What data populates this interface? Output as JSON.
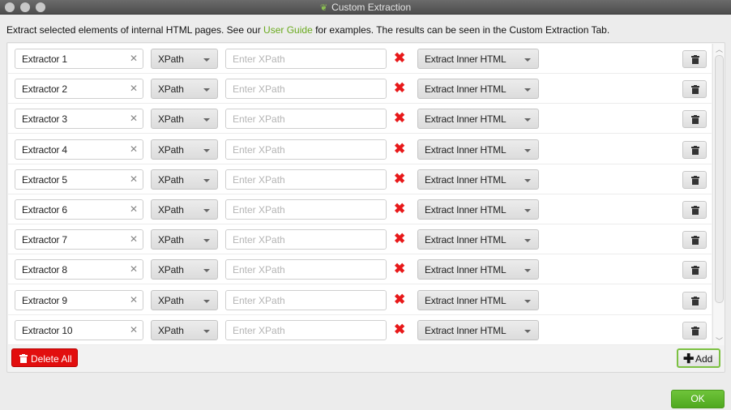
{
  "window": {
    "title": "Custom Extraction"
  },
  "description": {
    "before_link": "Extract selected elements of internal HTML pages. See our ",
    "link_text": "User Guide",
    "after_link": " for examples. The results can be seen in the Custom Extraction Tab."
  },
  "extractors": [
    {
      "name": "Extractor 1",
      "type": "XPath",
      "expression_placeholder": "Enter XPath",
      "mode": "Extract Inner HTML"
    },
    {
      "name": "Extractor 2",
      "type": "XPath",
      "expression_placeholder": "Enter XPath",
      "mode": "Extract Inner HTML"
    },
    {
      "name": "Extractor 3",
      "type": "XPath",
      "expression_placeholder": "Enter XPath",
      "mode": "Extract Inner HTML"
    },
    {
      "name": "Extractor 4",
      "type": "XPath",
      "expression_placeholder": "Enter XPath",
      "mode": "Extract Inner HTML"
    },
    {
      "name": "Extractor 5",
      "type": "XPath",
      "expression_placeholder": "Enter XPath",
      "mode": "Extract Inner HTML"
    },
    {
      "name": "Extractor 6",
      "type": "XPath",
      "expression_placeholder": "Enter XPath",
      "mode": "Extract Inner HTML"
    },
    {
      "name": "Extractor 7",
      "type": "XPath",
      "expression_placeholder": "Enter XPath",
      "mode": "Extract Inner HTML"
    },
    {
      "name": "Extractor 8",
      "type": "XPath",
      "expression_placeholder": "Enter XPath",
      "mode": "Extract Inner HTML"
    },
    {
      "name": "Extractor 9",
      "type": "XPath",
      "expression_placeholder": "Enter XPath",
      "mode": "Extract Inner HTML"
    },
    {
      "name": "Extractor 10",
      "type": "XPath",
      "expression_placeholder": "Enter XPath",
      "mode": "Extract Inner HTML"
    }
  ],
  "icons": {
    "clear": "✕",
    "invalid": "✖",
    "plus": "✚",
    "scroll_up": "︿",
    "scroll_down": "﹀"
  },
  "buttons": {
    "delete_all": "Delete All",
    "add": "Add",
    "ok": "OK"
  },
  "colors": {
    "link": "#6aaa1e",
    "delete": "#e20e0e",
    "ok": "#5cb82a",
    "invalid": "#e8191a"
  }
}
